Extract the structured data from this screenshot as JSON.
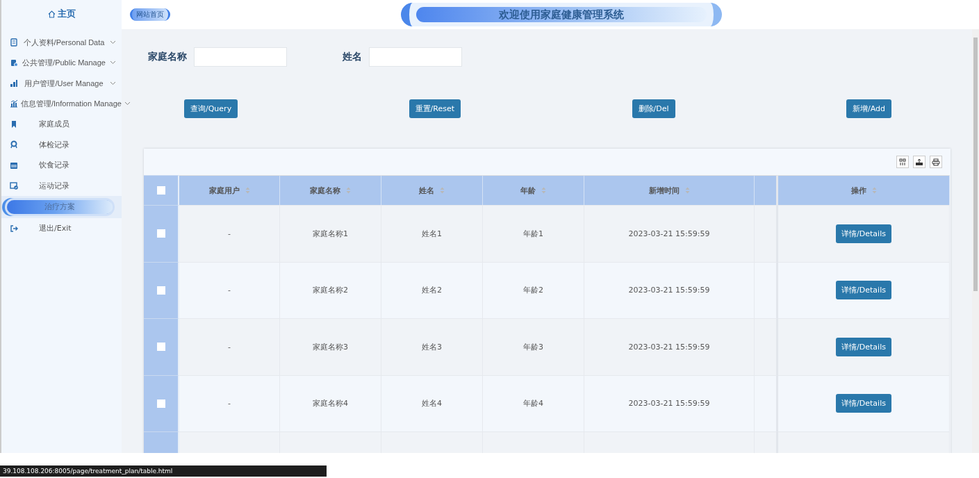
{
  "header": {
    "home_link": "网站首页",
    "title": "欢迎使用家庭健康管理系统"
  },
  "sidebar": {
    "home": "主页",
    "items": [
      {
        "kind": "group",
        "label": "个人资料/Personal Data"
      },
      {
        "kind": "group",
        "label": "公共管理/Public Manage"
      },
      {
        "kind": "group",
        "label": "用户管理/User Manage"
      },
      {
        "kind": "group",
        "label": "信息管理/Information Manage",
        "children": [
          {
            "label": "家庭成员",
            "selected": false
          },
          {
            "label": "体检记录",
            "selected": false
          },
          {
            "label": "饮食记录",
            "selected": false
          },
          {
            "label": "运动记录",
            "selected": false
          },
          {
            "label": "治疗方案",
            "selected": true
          }
        ]
      },
      {
        "kind": "link",
        "label": "退出/Exit"
      }
    ]
  },
  "search": {
    "fields": [
      {
        "label": "家庭名称"
      },
      {
        "label": "姓名"
      }
    ]
  },
  "buttons": [
    "查询/Query",
    "重置/Reset",
    "删除/Del",
    "新增/Add"
  ],
  "table": {
    "all_checked": false,
    "columns": [
      "家庭用户",
      "家庭名称",
      "姓名",
      "年龄",
      "新增时间",
      "操作"
    ],
    "rows": [
      {
        "checked": false,
        "cells": [
          "-",
          "家庭名称1",
          "姓名1",
          "年龄1",
          "2023-03-21 15:59:59"
        ],
        "action": "详情/Details"
      },
      {
        "checked": false,
        "cells": [
          "-",
          "家庭名称2",
          "姓名2",
          "年龄2",
          "2023-03-21 15:59:59"
        ],
        "action": "详情/Details"
      },
      {
        "checked": false,
        "cells": [
          "-",
          "家庭名称3",
          "姓名3",
          "年龄3",
          "2023-03-21 15:59:59"
        ],
        "action": "详情/Details"
      },
      {
        "checked": false,
        "cells": [
          "-",
          "家庭名称4",
          "姓名4",
          "年龄4",
          "2023-03-21 15:59:59"
        ],
        "action": "详情/Details"
      }
    ]
  },
  "status_bar": {
    "url": "39.108.108.206:8005/page/treatment_plan/table.html"
  }
}
